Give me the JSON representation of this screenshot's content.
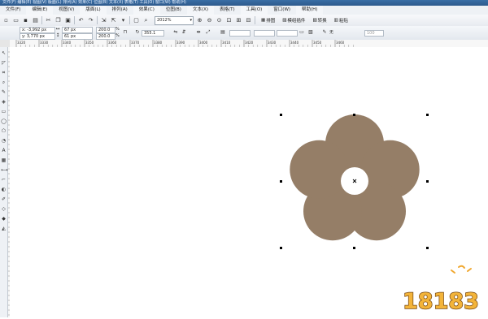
{
  "window": {
    "title": "文件(F) 编辑(E) 视图(V) 版面(L) 排列(A) 效果(C) 位图(B) 文本(X) 表格(T) 工具(O) 窗口(W) 帮助(H)"
  },
  "menu": [
    "文件(F)",
    "编辑(E)",
    "视图(V)",
    "版面(L)",
    "排列(A)",
    "效果(C)",
    "位图(B)",
    "文本(X)",
    "表格(T)",
    "工具(O)",
    "窗口(W)",
    "帮助(H)"
  ],
  "toolbar": {
    "zoom": "2012%",
    "buttons": {
      "arrange": "排图",
      "wrap": "模组插件",
      "convert": "转换",
      "paste": "粘贴"
    }
  },
  "properties": {
    "x": "x: -3,992 px",
    "y": "y: 3,770 px",
    "width": "67 px",
    "height": "61 px",
    "scale_x": "200.0",
    "scale_y": "200.0",
    "percent": "%",
    "rotation": "355.1",
    "outline": "无",
    "opacity": "100"
  },
  "ruler": {
    "h_ticks": [
      "3320",
      "3330",
      "3340",
      "3350",
      "3360",
      "3370",
      "3380",
      "3390",
      "3400",
      "3410",
      "3420",
      "3430",
      "3440",
      "3450",
      "3460"
    ]
  },
  "shape": {
    "fill": "#957e67",
    "name": "flower"
  },
  "watermark": {
    "brand": "18183"
  }
}
